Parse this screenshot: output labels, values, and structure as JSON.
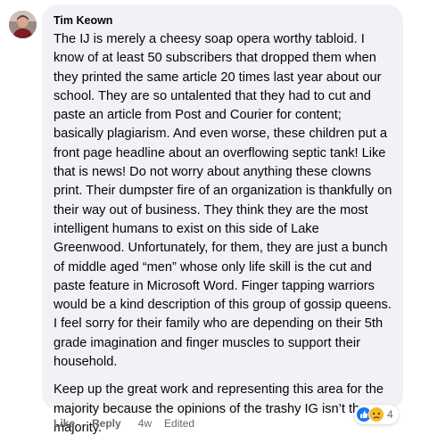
{
  "comment": {
    "author": "Tim Keown",
    "paragraphs": [
      "The IJ is merely a cheesy soap opera worthy tabloid. I know of at least 50 subscribers that dropped them when they printed the same article 20 times last year about our school. They are so untalented that they had to cut and paste an article from Post and Courier for content; basically plagiarism. And even worse, these children put a front page headline about an overflowing septic tank! Like that is news! Do not worry about anything these clowns print. Their dumpster fire of an organization is thankfully on their way out of business. They think they are the most intelligent humans to exist on this side of Lake Greenwood. Unfortunately, for them, they are just a bunch of middle aged “men” whose only life skill is the cut and paste feature in Microsoft Word. Finger tapping warriors would be a kind description of this group of gossip queens. I feel sorry for their family who are depending on their 5th grade imagination and finger muscles to support their household.",
      "Keep up the great work and representing this area for the majority because the opinions of the trashy IG isn’t the majority."
    ],
    "actions": {
      "like_label": "Like",
      "reply_label": "Reply",
      "time_ago": "4w",
      "edited_label": "Edited"
    },
    "reactions": {
      "icons": [
        "like-icon",
        "sad-icon"
      ],
      "count": "4"
    }
  },
  "colors": {
    "bubble_bg": "#f0f2f5",
    "meta_text": "#65676b",
    "like_blue": "#1877f2",
    "sad_yellow": "#f7b928"
  }
}
